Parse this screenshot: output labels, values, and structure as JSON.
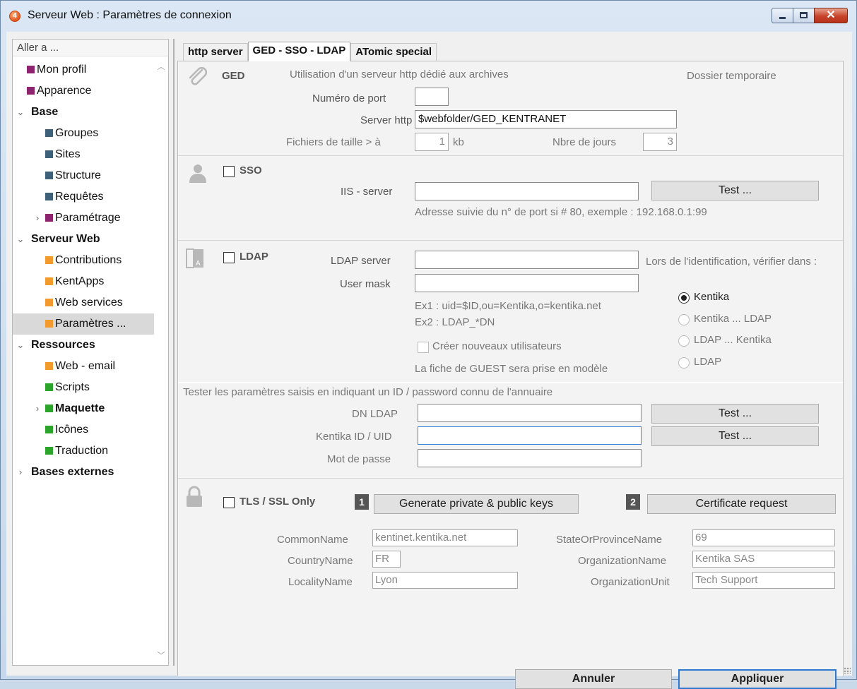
{
  "window": {
    "title": "Serveur Web : Paramètres de connexion"
  },
  "sidebar": {
    "header": "Aller a ...",
    "items": [
      {
        "label": "Mon profil",
        "color": "#8e2370",
        "indent": 1
      },
      {
        "label": "Apparence",
        "color": "#8e2370",
        "indent": 1
      },
      {
        "label": "Base",
        "group": true,
        "expanded": true
      },
      {
        "label": "Groupes",
        "color": "#3d6178",
        "indent": 2
      },
      {
        "label": "Sites",
        "color": "#3d6178",
        "indent": 2
      },
      {
        "label": "Structure",
        "color": "#3d6178",
        "indent": 2
      },
      {
        "label": "Requêtes",
        "color": "#3d6178",
        "indent": 2
      },
      {
        "label": "Paramétrage",
        "color": "#8e2370",
        "indent": 2,
        "collapsed": true
      },
      {
        "label": "Serveur Web",
        "group": true,
        "expanded": true
      },
      {
        "label": "Contributions",
        "color": "#f39a2d",
        "indent": 2
      },
      {
        "label": "KentApps",
        "color": "#f39a2d",
        "indent": 2
      },
      {
        "label": "Web services",
        "color": "#f39a2d",
        "indent": 2
      },
      {
        "label": "Paramètres ...",
        "color": "#f39a2d",
        "indent": 2,
        "selected": true
      },
      {
        "label": "Ressources",
        "group": true,
        "expanded": true
      },
      {
        "label": "Web - email",
        "color": "#f39a2d",
        "indent": 2
      },
      {
        "label": "Scripts",
        "color": "#2aa52a",
        "indent": 2
      },
      {
        "label": "Maquette",
        "color": "#2aa52a",
        "indent": 2,
        "collapsed": true,
        "bold": true
      },
      {
        "label": "Icônes",
        "color": "#2aa52a",
        "indent": 2
      },
      {
        "label": "Traduction",
        "color": "#2aa52a",
        "indent": 2
      },
      {
        "label": "Bases externes",
        "group": true,
        "expanded": false
      }
    ]
  },
  "tabs": [
    {
      "label": "http server",
      "active": false
    },
    {
      "label": "GED - SSO - LDAP",
      "active": true
    },
    {
      "label": "ATomic special",
      "active": false
    }
  ],
  "ged": {
    "icon": "paperclip-icon",
    "title": "GED",
    "subtitle": "Utilisation d'un serveur http dédié aux archives",
    "temp_label": "Dossier temporaire",
    "port_label": "Numéro de port",
    "port_value": "",
    "server_label": "Server http",
    "server_value": "$webfolder/GED_KENTRANET",
    "size_label": "Fichiers de taille > à",
    "size_value": "1",
    "size_unit": "kb",
    "days_label": "Nbre de jours",
    "days_value": "3"
  },
  "sso": {
    "icon": "user-icon",
    "checkbox_label": "SSO",
    "checked": false,
    "iis_label": "IIS - server",
    "iis_value": "",
    "test_label": "Test ...",
    "hint": "Adresse suivie du n° de port si # 80, exemple : 192.168.0.1:99"
  },
  "ldap": {
    "icon": "address-book-icon",
    "checkbox_label": "LDAP",
    "checked": false,
    "server_label": "LDAP server",
    "server_value": "",
    "mask_label": "User mask",
    "mask_value": "",
    "ex1": "Ex1 : uid=$ID,ou=Kentika,o=kentika.net",
    "ex2": "Ex2 : LDAP_*DN",
    "create_label": "Créer nouveaux utilisateurs",
    "create_checked": false,
    "guest_note": "La fiche de GUEST sera prise en modèle",
    "verify_label": "Lors de l'identification, vérifier dans :",
    "options": [
      {
        "label": "Kentika",
        "selected": true
      },
      {
        "label": "Kentika ... LDAP",
        "selected": false
      },
      {
        "label": "LDAP ... Kentika",
        "selected": false
      },
      {
        "label": "LDAP",
        "selected": false
      }
    ]
  },
  "test": {
    "intro": "Tester les paramètres saisis en indiquant un ID / password connu de l'annuaire",
    "dn_label": "DN LDAP",
    "dn_value": "",
    "id_label": "Kentika ID / UID",
    "id_value": "",
    "pwd_label": "Mot de passe",
    "pwd_value": "",
    "test1_label": "Test ...",
    "test2_label": "Test ..."
  },
  "tls": {
    "icon": "lock-icon",
    "checkbox_label": "TLS / SSL Only",
    "checked": false,
    "step1": "1",
    "gen_keys_label": "Generate private & public keys",
    "step2": "2",
    "cert_label": "Certificate request",
    "common_name_label": "CommonName",
    "common_name_value": "kentinet.kentika.net",
    "country_label": "CountryName",
    "country_value": "FR",
    "locality_label": "LocalityName",
    "locality_value": "Lyon",
    "state_label": "StateOrProvinceName",
    "state_value": "69",
    "org_label": "OrganizationName",
    "org_value": "Kentika SAS",
    "unit_label": "OrganizationUnit",
    "unit_value": "Tech Support"
  },
  "footer": {
    "cancel_label": "Annuler",
    "apply_label": "Appliquer"
  }
}
